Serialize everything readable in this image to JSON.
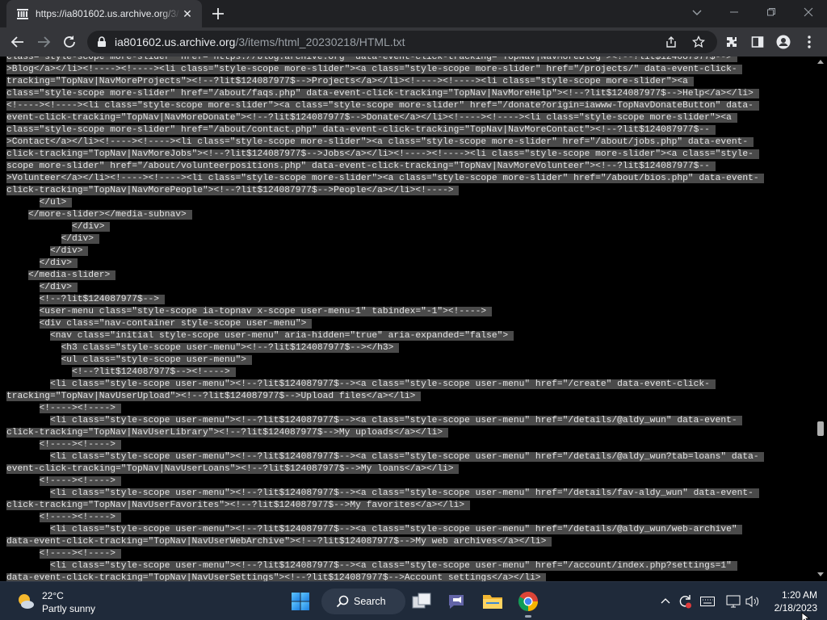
{
  "browser": {
    "tab_title": "https://ia801602.us.archive.org/3/",
    "url_host": "ia801602.us.archive.org",
    "url_path": "/3/items/html_20230218/HTML.txt"
  },
  "code_lines": [
    "class=\"style-scope more-slider\" href=\"https://blog.archive.org\" data-event-click-tracking=\"TopNav|NavMoreBlog\"><!--?lit$124087977$-->",
    ">Blog</a></li><!----><!----><li class=\"style-scope more-slider\"><a class=\"style-scope more-slider\" href=\"/projects/\" data-event-click-",
    "tracking=\"TopNav|NavMoreProjects\"><!--?lit$124087977$-->Projects</a></li><!----><!----><li class=\"style-scope more-slider\"><a",
    "class=\"style-scope more-slider\" href=\"/about/faqs.php\" data-event-click-tracking=\"TopNav|NavMoreHelp\"><!--?lit$124087977$-->Help</a></li>",
    "<!----><!----><li class=\"style-scope more-slider\"><a class=\"style-scope more-slider\" href=\"/donate?origin=iawww-TopNavDonateButton\" data-",
    "event-click-tracking=\"TopNav|NavMoreDonate\"><!--?lit$124087977$-->Donate</a></li><!----><!----><li class=\"style-scope more-slider\"><a",
    "class=\"style-scope more-slider\" href=\"/about/contact.php\" data-event-click-tracking=\"TopNav|NavMoreContact\"><!--?lit$124087977$--",
    ">Contact</a></li><!----><!----><li class=\"style-scope more-slider\"><a class=\"style-scope more-slider\" href=\"/about/jobs.php\" data-event-",
    "click-tracking=\"TopNav|NavMoreJobs\"><!--?lit$124087977$-->Jobs</a></li><!----><!----><li class=\"style-scope more-slider\"><a class=\"style-",
    "scope more-slider\" href=\"/about/volunteerpositions.php\" data-event-click-tracking=\"TopNav|NavMoreVolunteer\"><!--?lit$124087977$--",
    ">Volunteer</a></li><!----><!----><li class=\"style-scope more-slider\"><a class=\"style-scope more-slider\" href=\"/about/bios.php\" data-event-",
    "click-tracking=\"TopNav|NavMorePeople\"><!--?lit$124087977$-->People</a></li><!---->",
    "      </ul>",
    "    </more-slider></media-subnav>",
    "            </div>",
    "          </div>",
    "        </div>",
    "      </div>",
    "    </media-slider>",
    "      </div>",
    "      <!--?lit$124087977$-->",
    "      <user-menu class=\"style-scope ia-topnav x-scope user-menu-1\" tabindex=\"-1\"><!---->",
    "      <div class=\"nav-container style-scope user-menu\">",
    "        <nav class=\"initial style-scope user-menu\" aria-hidden=\"true\" aria-expanded=\"false\">",
    "          <h3 class=\"style-scope user-menu\"><!--?lit$124087977$--></h3>",
    "          <ul class=\"style-scope user-menu\">",
    "            <!--?lit$124087977$--><!---->",
    "        <li class=\"style-scope user-menu\"><!--?lit$124087977$--><a class=\"style-scope user-menu\" href=\"/create\" data-event-click-",
    "tracking=\"TopNav|NavUserUpload\"><!--?lit$124087977$-->Upload files</a></li>",
    "      <!----><!---->",
    "        <li class=\"style-scope user-menu\"><!--?lit$124087977$--><a class=\"style-scope user-menu\" href=\"/details/@aldy_wun\" data-event-",
    "click-tracking=\"TopNav|NavUserLibrary\"><!--?lit$124087977$-->My uploads</a></li>",
    "      <!----><!---->",
    "        <li class=\"style-scope user-menu\"><!--?lit$124087977$--><a class=\"style-scope user-menu\" href=\"/details/@aldy_wun?tab=loans\" data-",
    "event-click-tracking=\"TopNav|NavUserLoans\"><!--?lit$124087977$-->My loans</a></li>",
    "      <!----><!---->",
    "        <li class=\"style-scope user-menu\"><!--?lit$124087977$--><a class=\"style-scope user-menu\" href=\"/details/fav-aldy_wun\" data-event-",
    "click-tracking=\"TopNav|NavUserFavorites\"><!--?lit$124087977$-->My favorites</a></li>",
    "      <!----><!---->",
    "        <li class=\"style-scope user-menu\"><!--?lit$124087977$--><a class=\"style-scope user-menu\" href=\"/details/@aldy_wun/web-archive\"",
    "data-event-click-tracking=\"TopNav|NavUserWebArchive\"><!--?lit$124087977$-->My web archives</a></li>",
    "      <!----><!---->",
    "        <li class=\"style-scope user-menu\"><!--?lit$124087977$--><a class=\"style-scope user-menu\" href=\"/account/index.php?settings=1\"",
    "data-event-click-tracking=\"TopNav|NavUserSettings\"><!--?lit$124087977$-->Account settings</a></li>"
  ],
  "taskbar": {
    "temperature": "22°C",
    "condition": "Partly sunny",
    "search_label": "Search",
    "time": "1:20 AM",
    "date": "2/18/2023"
  },
  "colors": {
    "tab_strip": "#202124",
    "toolbar": "#35363a",
    "selection": "#4a4a4a",
    "taskbar": "#1f2a3a"
  }
}
